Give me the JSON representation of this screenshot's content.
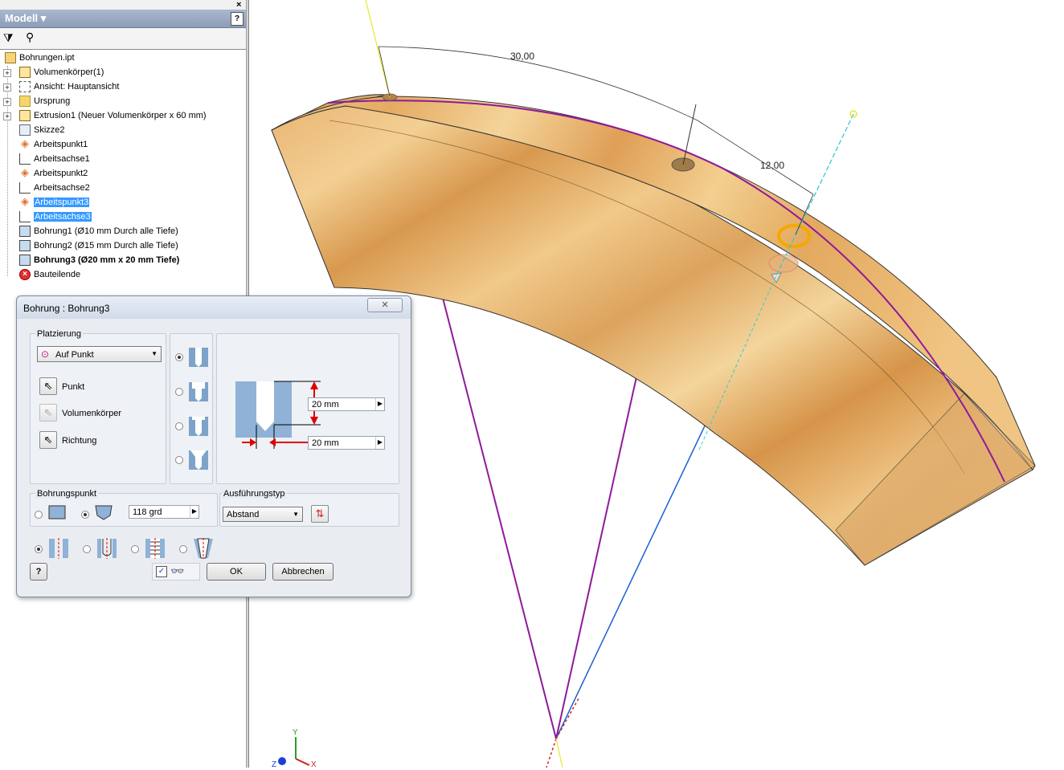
{
  "browser": {
    "title": "Modell",
    "close": "×",
    "help": "?",
    "items": [
      {
        "label": "Bohrungen.ipt",
        "icon": "part-file-icon",
        "expandable": false,
        "selected": false,
        "bold": false
      },
      {
        "label": "Volumenkörper(1)",
        "icon": "solid-bodies-icon",
        "expandable": true,
        "selected": false,
        "bold": false
      },
      {
        "label": "Ansicht: Hauptansicht",
        "icon": "view-rep-icon",
        "expandable": true,
        "selected": false,
        "bold": false
      },
      {
        "label": "Ursprung",
        "icon": "origin-folder-icon",
        "expandable": true,
        "selected": false,
        "bold": false
      },
      {
        "label": "Extrusion1 (Neuer Volumenkörper x 60 mm)",
        "icon": "extrusion-icon",
        "expandable": true,
        "selected": false,
        "bold": false
      },
      {
        "label": "Skizze2",
        "icon": "sketch-icon",
        "expandable": false,
        "selected": false,
        "bold": false
      },
      {
        "label": "Arbeitspunkt1",
        "icon": "work-point-icon",
        "expandable": false,
        "selected": false,
        "bold": false
      },
      {
        "label": "Arbeitsachse1",
        "icon": "work-axis-icon",
        "expandable": false,
        "selected": false,
        "bold": false
      },
      {
        "label": "Arbeitspunkt2",
        "icon": "work-point-icon",
        "expandable": false,
        "selected": false,
        "bold": false
      },
      {
        "label": "Arbeitsachse2",
        "icon": "work-axis-icon",
        "expandable": false,
        "selected": false,
        "bold": false
      },
      {
        "label": "Arbeitspunkt3",
        "icon": "work-point-icon",
        "expandable": false,
        "selected": true,
        "bold": false
      },
      {
        "label": "Arbeitsachse3",
        "icon": "work-axis-icon",
        "expandable": false,
        "selected": true,
        "bold": false
      },
      {
        "label": "Bohrung1 (Ø10 mm Durch alle Tiefe)",
        "icon": "hole-icon",
        "expandable": false,
        "selected": false,
        "bold": false
      },
      {
        "label": "Bohrung2 (Ø15 mm Durch alle Tiefe)",
        "icon": "hole-icon",
        "expandable": false,
        "selected": false,
        "bold": false
      },
      {
        "label": "Bohrung3 (Ø20 mm x 20 mm Tiefe)",
        "icon": "hole-icon",
        "expandable": false,
        "selected": false,
        "bold": true
      },
      {
        "label": "Bauteilende",
        "icon": "end-of-part-icon",
        "expandable": false,
        "selected": false,
        "bold": false
      }
    ]
  },
  "viewport": {
    "dim_angle": "30,00",
    "dim_length": "12,00",
    "colors": {
      "wood_light": "#f2c98a",
      "wood_dark": "#d99a52",
      "sketch": "#8e1a9a",
      "axis_cyan": "#33cccc",
      "axis_blue": "#1a5fd6",
      "highlight": "#f5a800"
    },
    "triad": {
      "x": "X",
      "y": "Y",
      "z": "Z"
    }
  },
  "dialog": {
    "title": "Bohrung : Bohrung3",
    "close": "✕",
    "placement": {
      "label": "Platzierung",
      "selected": "Auf Punkt",
      "point": "Punkt",
      "solid": "Volumenkörper",
      "direction": "Richtung"
    },
    "dims": {
      "depth": "20 mm",
      "diameter": "20 mm"
    },
    "drill_point": {
      "label": "Bohrungspunkt",
      "angle": "118 grd"
    },
    "termination": {
      "label": "Ausführungstyp",
      "selected": "Abstand"
    },
    "ok": "OK",
    "cancel": "Abbrechen",
    "help": "?"
  }
}
